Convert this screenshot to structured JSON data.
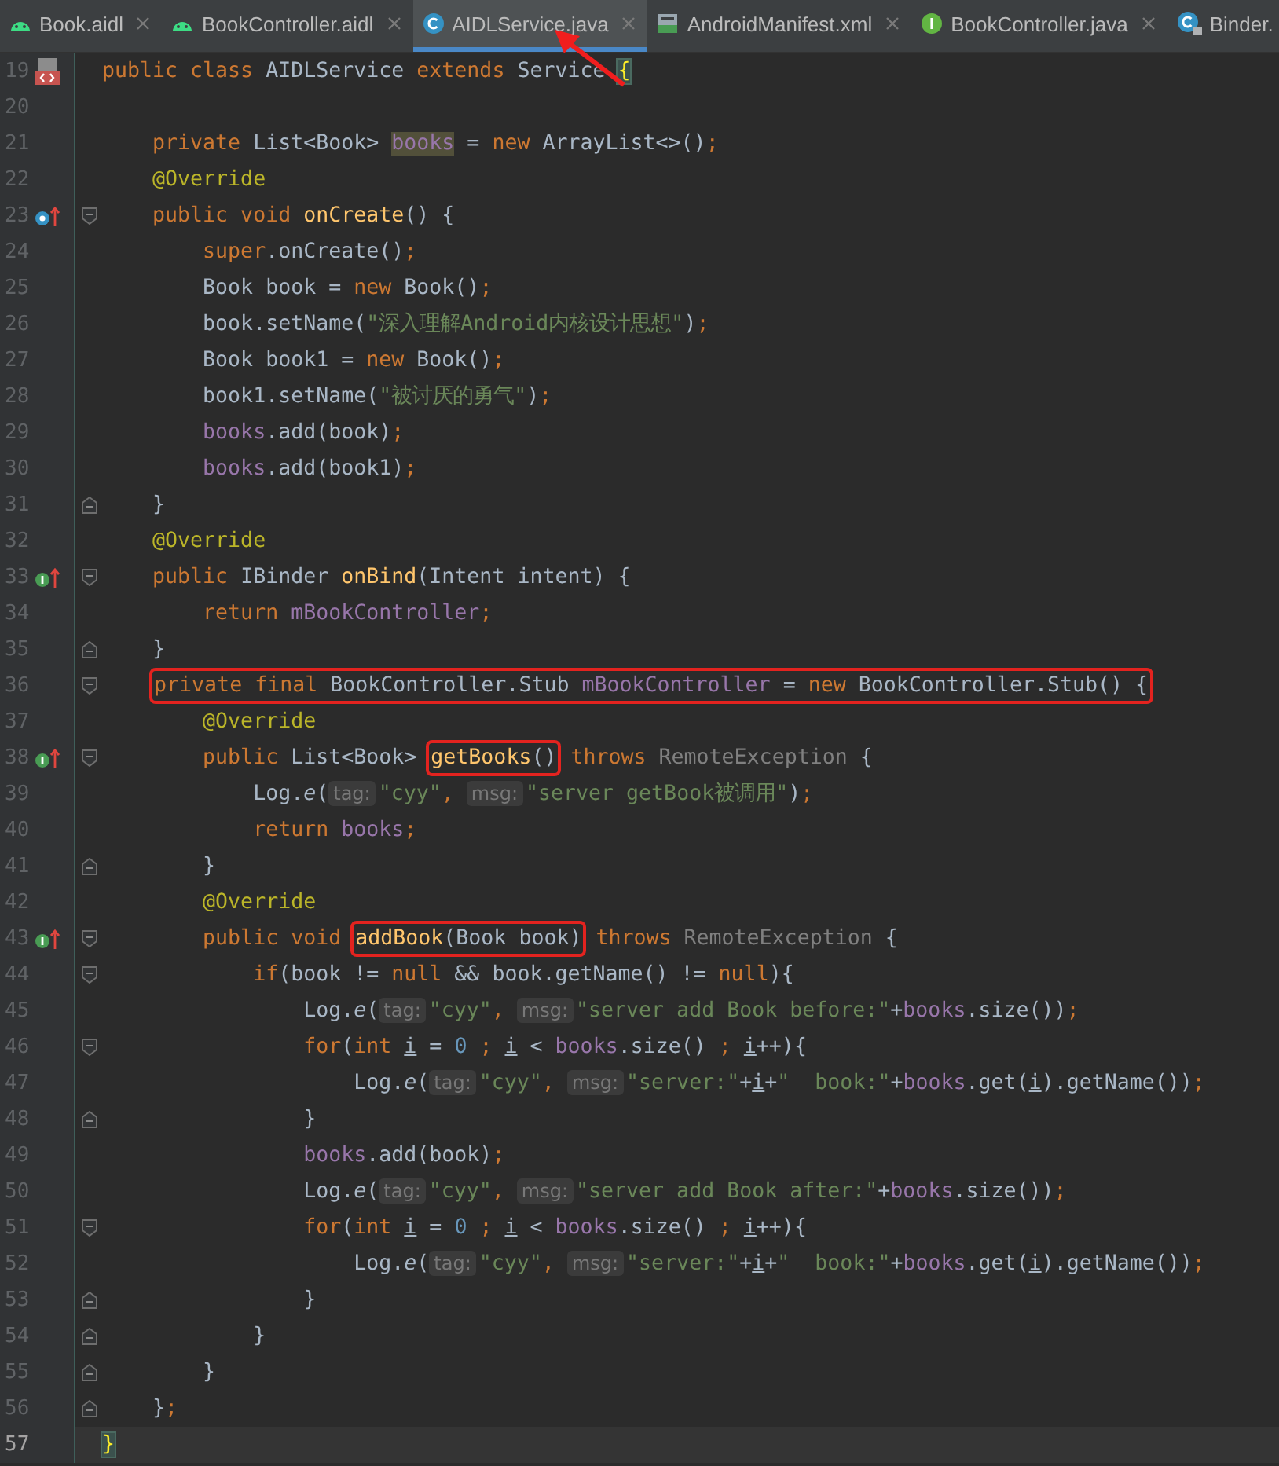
{
  "tabs": [
    {
      "label": "Book.aidl",
      "kind": "android",
      "selected": false,
      "closable": true
    },
    {
      "label": "BookController.aidl",
      "kind": "android",
      "selected": false,
      "closable": true
    },
    {
      "label": "AIDLService.java",
      "kind": "class",
      "selected": true,
      "closable": true
    },
    {
      "label": "AndroidManifest.xml",
      "kind": "manifest",
      "selected": false,
      "closable": true
    },
    {
      "label": "BookController.java",
      "kind": "interface",
      "selected": false,
      "closable": true
    },
    {
      "label": "Binder.",
      "kind": "locked-class",
      "selected": false,
      "closable": false
    }
  ],
  "editor": {
    "lines": [
      {
        "number": "19",
        "gutter_icon": {
          "kind": "class"
        },
        "current": false,
        "tokens": [
          {
            "kind": "keyword",
            "text": "public class "
          },
          {
            "kind": "plain",
            "text": "AIDLService "
          },
          {
            "kind": "keyword",
            "text": "extends "
          },
          {
            "kind": "plain",
            "text": "Service "
          },
          {
            "kind": "brace",
            "text": "{"
          }
        ]
      },
      {
        "number": "20",
        "current": false
      },
      {
        "number": "21",
        "current": false,
        "tokens": [
          {
            "kind": "keyword",
            "text": "    private "
          },
          {
            "kind": "plain",
            "text": "List<Book> "
          },
          {
            "kind": "field-highlight",
            "text": "books"
          },
          {
            "kind": "plain",
            "text": " = "
          },
          {
            "kind": "keyword",
            "text": "new "
          },
          {
            "kind": "plain",
            "text": "ArrayList<>()"
          },
          {
            "kind": "keyword",
            "text": ";"
          }
        ]
      },
      {
        "number": "22",
        "current": false,
        "tokens": [
          {
            "kind": "annotation",
            "text": "    @Override"
          }
        ]
      },
      {
        "number": "23",
        "gutter_icon": {
          "kind": "override"
        },
        "fold_marker": {
          "kind": "start"
        },
        "current": false,
        "tokens": [
          {
            "kind": "keyword",
            "text": "    public void "
          },
          {
            "kind": "declaration",
            "text": "onCreate"
          },
          {
            "kind": "plain",
            "text": "() {"
          }
        ]
      },
      {
        "number": "24",
        "current": false,
        "tokens": [
          {
            "kind": "keyword",
            "text": "        super"
          },
          {
            "kind": "plain",
            "text": ".onCreate()"
          },
          {
            "kind": "keyword",
            "text": ";"
          }
        ]
      },
      {
        "number": "25",
        "current": false,
        "tokens": [
          {
            "kind": "plain",
            "text": "        Book book = "
          },
          {
            "kind": "keyword",
            "text": "new "
          },
          {
            "kind": "plain",
            "text": "Book()"
          },
          {
            "kind": "keyword",
            "text": ";"
          }
        ]
      },
      {
        "number": "26",
        "current": false,
        "tokens": [
          {
            "kind": "plain",
            "text": "        book.setName("
          },
          {
            "kind": "string",
            "text": "\"深入理解Android内核设计思想\""
          },
          {
            "kind": "plain",
            "text": ")"
          },
          {
            "kind": "keyword",
            "text": ";"
          }
        ]
      },
      {
        "number": "27",
        "current": false,
        "tokens": [
          {
            "kind": "plain",
            "text": "        Book book1 = "
          },
          {
            "kind": "keyword",
            "text": "new "
          },
          {
            "kind": "plain",
            "text": "Book()"
          },
          {
            "kind": "keyword",
            "text": ";"
          }
        ]
      },
      {
        "number": "28",
        "current": false,
        "tokens": [
          {
            "kind": "plain",
            "text": "        book1.setName("
          },
          {
            "kind": "string",
            "text": "\"被讨厌的勇气\""
          },
          {
            "kind": "plain",
            "text": ")"
          },
          {
            "kind": "keyword",
            "text": ";"
          }
        ]
      },
      {
        "number": "29",
        "current": false,
        "tokens": [
          {
            "kind": "field",
            "text": "        books"
          },
          {
            "kind": "plain",
            "text": ".add(book)"
          },
          {
            "kind": "keyword",
            "text": ";"
          }
        ]
      },
      {
        "number": "30",
        "current": false,
        "tokens": [
          {
            "kind": "field",
            "text": "        books"
          },
          {
            "kind": "plain",
            "text": ".add(book1)"
          },
          {
            "kind": "keyword",
            "text": ";"
          }
        ]
      },
      {
        "number": "31",
        "fold_marker": {
          "kind": "end"
        },
        "current": false,
        "tokens": [
          {
            "kind": "plain",
            "text": "    }"
          }
        ]
      },
      {
        "number": "32",
        "current": false,
        "tokens": [
          {
            "kind": "annotation",
            "text": "    @Override"
          }
        ]
      },
      {
        "number": "33",
        "gutter_icon": {
          "kind": "implement"
        },
        "fold_marker": {
          "kind": "start"
        },
        "current": false,
        "tokens": [
          {
            "kind": "keyword",
            "text": "    public "
          },
          {
            "kind": "plain",
            "text": "IBinder "
          },
          {
            "kind": "declaration",
            "text": "onBind"
          },
          {
            "kind": "plain",
            "text": "(Intent intent) {"
          }
        ]
      },
      {
        "number": "34",
        "current": false,
        "tokens": [
          {
            "kind": "keyword",
            "text": "        return "
          },
          {
            "kind": "field",
            "text": "mBookController"
          },
          {
            "kind": "keyword",
            "text": ";"
          }
        ]
      },
      {
        "number": "35",
        "fold_marker": {
          "kind": "end"
        },
        "current": false,
        "tokens": [
          {
            "kind": "plain",
            "text": "    }"
          }
        ]
      },
      {
        "number": "36",
        "fold_marker": {
          "kind": "start"
        },
        "current": false,
        "tokens": [
          {
            "kind": "box",
            "tokens": [
              {
                "kind": "keyword",
                "text": "    private final "
              },
              {
                "kind": "plain",
                "text": "BookController.Stub "
              },
              {
                "kind": "field",
                "text": "mBookController"
              },
              {
                "kind": "plain",
                "text": " = "
              },
              {
                "kind": "keyword",
                "text": "new "
              },
              {
                "kind": "plain",
                "text": "BookController.Stub() {"
              }
            ]
          }
        ]
      },
      {
        "number": "37",
        "current": false,
        "tokens": [
          {
            "kind": "annotation",
            "text": "        @Override"
          }
        ]
      },
      {
        "number": "38",
        "gutter_icon": {
          "kind": "implement"
        },
        "fold_marker": {
          "kind": "start"
        },
        "current": false,
        "tokens": [
          {
            "kind": "keyword",
            "text": "        public "
          },
          {
            "kind": "plain",
            "text": "List<Book> "
          },
          {
            "kind": "box",
            "tokens": [
              {
                "kind": "declaration",
                "text": "getBooks"
              },
              {
                "kind": "plain",
                "text": "()"
              }
            ]
          },
          {
            "kind": "keyword",
            "text": " throws "
          },
          {
            "kind": "muted",
            "text": "RemoteException"
          },
          {
            "kind": "plain",
            "text": " {"
          }
        ]
      },
      {
        "number": "39",
        "current": false,
        "tokens": [
          {
            "kind": "plain",
            "text": "            Log."
          },
          {
            "kind": "italic",
            "text": "e"
          },
          {
            "kind": "plain",
            "text": "("
          },
          {
            "kind": "hint",
            "text": "tag:"
          },
          {
            "kind": "string",
            "text": "\"cyy\""
          },
          {
            "kind": "keyword",
            "text": ", "
          },
          {
            "kind": "hint",
            "text": "msg:"
          },
          {
            "kind": "string",
            "text": "\"server getBook被调用\""
          },
          {
            "kind": "plain",
            "text": ")"
          },
          {
            "kind": "keyword",
            "text": ";"
          }
        ]
      },
      {
        "number": "40",
        "current": false,
        "tokens": [
          {
            "kind": "keyword",
            "text": "            return "
          },
          {
            "kind": "field",
            "text": "books"
          },
          {
            "kind": "keyword",
            "text": ";"
          }
        ]
      },
      {
        "number": "41",
        "fold_marker": {
          "kind": "end"
        },
        "current": false,
        "tokens": [
          {
            "kind": "plain",
            "text": "        }"
          }
        ]
      },
      {
        "number": "42",
        "current": false,
        "tokens": [
          {
            "kind": "annotation",
            "text": "        @Override"
          }
        ]
      },
      {
        "number": "43",
        "gutter_icon": {
          "kind": "implement"
        },
        "fold_marker": {
          "kind": "start"
        },
        "current": false,
        "tokens": [
          {
            "kind": "keyword",
            "text": "        public void "
          },
          {
            "kind": "box",
            "tokens": [
              {
                "kind": "declaration",
                "text": "addBook"
              },
              {
                "kind": "plain",
                "text": "(Book book)"
              }
            ]
          },
          {
            "kind": "keyword",
            "text": " throws "
          },
          {
            "kind": "muted",
            "text": "RemoteException"
          },
          {
            "kind": "plain",
            "text": " {"
          }
        ]
      },
      {
        "number": "44",
        "fold_marker": {
          "kind": "start"
        },
        "current": false,
        "tokens": [
          {
            "kind": "keyword",
            "text": "            if"
          },
          {
            "kind": "plain",
            "text": "(book != "
          },
          {
            "kind": "keyword",
            "text": "null "
          },
          {
            "kind": "plain",
            "text": "&& book.getName() != "
          },
          {
            "kind": "keyword",
            "text": "null"
          },
          {
            "kind": "plain",
            "text": "){"
          }
        ]
      },
      {
        "number": "45",
        "current": false,
        "tokens": [
          {
            "kind": "plain",
            "text": "                Log."
          },
          {
            "kind": "italic",
            "text": "e"
          },
          {
            "kind": "plain",
            "text": "("
          },
          {
            "kind": "hint",
            "text": "tag:"
          },
          {
            "kind": "string",
            "text": "\"cyy\""
          },
          {
            "kind": "keyword",
            "text": ", "
          },
          {
            "kind": "hint",
            "text": "msg:"
          },
          {
            "kind": "string",
            "text": "\"server add Book before:\""
          },
          {
            "kind": "plain",
            "text": "+"
          },
          {
            "kind": "field",
            "text": "books"
          },
          {
            "kind": "plain",
            "text": ".size())"
          },
          {
            "kind": "keyword",
            "text": ";"
          }
        ]
      },
      {
        "number": "46",
        "fold_marker": {
          "kind": "start"
        },
        "current": false,
        "tokens": [
          {
            "kind": "keyword",
            "text": "                for"
          },
          {
            "kind": "plain",
            "text": "("
          },
          {
            "kind": "keyword",
            "text": "int "
          },
          {
            "kind": "underlined",
            "text": "i"
          },
          {
            "kind": "plain",
            "text": " = "
          },
          {
            "kind": "number",
            "text": "0"
          },
          {
            "kind": "keyword",
            "text": " ; "
          },
          {
            "kind": "underlined",
            "text": "i"
          },
          {
            "kind": "plain",
            "text": " < "
          },
          {
            "kind": "field",
            "text": "books"
          },
          {
            "kind": "plain",
            "text": ".size()"
          },
          {
            "kind": "keyword",
            "text": " ; "
          },
          {
            "kind": "underlined",
            "text": "i"
          },
          {
            "kind": "plain",
            "text": "++){"
          }
        ]
      },
      {
        "number": "47",
        "current": false,
        "tokens": [
          {
            "kind": "plain",
            "text": "                    Log."
          },
          {
            "kind": "italic",
            "text": "e"
          },
          {
            "kind": "plain",
            "text": "("
          },
          {
            "kind": "hint",
            "text": "tag:"
          },
          {
            "kind": "string",
            "text": "\"cyy\""
          },
          {
            "kind": "keyword",
            "text": ", "
          },
          {
            "kind": "hint",
            "text": "msg:"
          },
          {
            "kind": "string",
            "text": "\"server:\""
          },
          {
            "kind": "plain",
            "text": "+"
          },
          {
            "kind": "underlined",
            "text": "i"
          },
          {
            "kind": "plain",
            "text": "+"
          },
          {
            "kind": "string",
            "text": "\"  book:\""
          },
          {
            "kind": "plain",
            "text": "+"
          },
          {
            "kind": "field",
            "text": "books"
          },
          {
            "kind": "plain",
            "text": ".get("
          },
          {
            "kind": "underlined",
            "text": "i"
          },
          {
            "kind": "plain",
            "text": ").getName())"
          },
          {
            "kind": "keyword",
            "text": ";"
          }
        ]
      },
      {
        "number": "48",
        "fold_marker": {
          "kind": "end"
        },
        "current": false,
        "tokens": [
          {
            "kind": "plain",
            "text": "                }"
          }
        ]
      },
      {
        "number": "49",
        "current": false,
        "tokens": [
          {
            "kind": "field",
            "text": "                books"
          },
          {
            "kind": "plain",
            "text": ".add(book)"
          },
          {
            "kind": "keyword",
            "text": ";"
          }
        ]
      },
      {
        "number": "50",
        "current": false,
        "tokens": [
          {
            "kind": "plain",
            "text": "                Log."
          },
          {
            "kind": "italic",
            "text": "e"
          },
          {
            "kind": "plain",
            "text": "("
          },
          {
            "kind": "hint",
            "text": "tag:"
          },
          {
            "kind": "string",
            "text": "\"cyy\""
          },
          {
            "kind": "keyword",
            "text": ", "
          },
          {
            "kind": "hint",
            "text": "msg:"
          },
          {
            "kind": "string",
            "text": "\"server add Book after:\""
          },
          {
            "kind": "plain",
            "text": "+"
          },
          {
            "kind": "field",
            "text": "books"
          },
          {
            "kind": "plain",
            "text": ".size())"
          },
          {
            "kind": "keyword",
            "text": ";"
          }
        ]
      },
      {
        "number": "51",
        "fold_marker": {
          "kind": "start"
        },
        "current": false,
        "tokens": [
          {
            "kind": "keyword",
            "text": "                for"
          },
          {
            "kind": "plain",
            "text": "("
          },
          {
            "kind": "keyword",
            "text": "int "
          },
          {
            "kind": "underlined",
            "text": "i"
          },
          {
            "kind": "plain",
            "text": " = "
          },
          {
            "kind": "number",
            "text": "0"
          },
          {
            "kind": "keyword",
            "text": " ; "
          },
          {
            "kind": "underlined",
            "text": "i"
          },
          {
            "kind": "plain",
            "text": " < "
          },
          {
            "kind": "field",
            "text": "books"
          },
          {
            "kind": "plain",
            "text": ".size()"
          },
          {
            "kind": "keyword",
            "text": " ; "
          },
          {
            "kind": "underlined",
            "text": "i"
          },
          {
            "kind": "plain",
            "text": "++){"
          }
        ]
      },
      {
        "number": "52",
        "current": false,
        "tokens": [
          {
            "kind": "plain",
            "text": "                    Log."
          },
          {
            "kind": "italic",
            "text": "e"
          },
          {
            "kind": "plain",
            "text": "("
          },
          {
            "kind": "hint",
            "text": "tag:"
          },
          {
            "kind": "string",
            "text": "\"cyy\""
          },
          {
            "kind": "keyword",
            "text": ", "
          },
          {
            "kind": "hint",
            "text": "msg:"
          },
          {
            "kind": "string",
            "text": "\"server:\""
          },
          {
            "kind": "plain",
            "text": "+"
          },
          {
            "kind": "underlined",
            "text": "i"
          },
          {
            "kind": "plain",
            "text": "+"
          },
          {
            "kind": "string",
            "text": "\"  book:\""
          },
          {
            "kind": "plain",
            "text": "+"
          },
          {
            "kind": "field",
            "text": "books"
          },
          {
            "kind": "plain",
            "text": ".get("
          },
          {
            "kind": "underlined",
            "text": "i"
          },
          {
            "kind": "plain",
            "text": ").getName())"
          },
          {
            "kind": "keyword",
            "text": ";"
          }
        ]
      },
      {
        "number": "53",
        "fold_marker": {
          "kind": "end"
        },
        "current": false,
        "tokens": [
          {
            "kind": "plain",
            "text": "                }"
          }
        ]
      },
      {
        "number": "54",
        "fold_marker": {
          "kind": "end"
        },
        "current": false,
        "tokens": [
          {
            "kind": "plain",
            "text": "            }"
          }
        ]
      },
      {
        "number": "55",
        "fold_marker": {
          "kind": "end"
        },
        "current": false,
        "tokens": [
          {
            "kind": "plain",
            "text": "        }"
          }
        ]
      },
      {
        "number": "56",
        "fold_marker": {
          "kind": "end"
        },
        "current": false,
        "tokens": [
          {
            "kind": "plain",
            "text": "    }"
          },
          {
            "kind": "keyword",
            "text": ";"
          }
        ]
      },
      {
        "number": "57",
        "current": true,
        "tokens": [
          {
            "kind": "brace",
            "text": "}"
          }
        ]
      }
    ]
  }
}
